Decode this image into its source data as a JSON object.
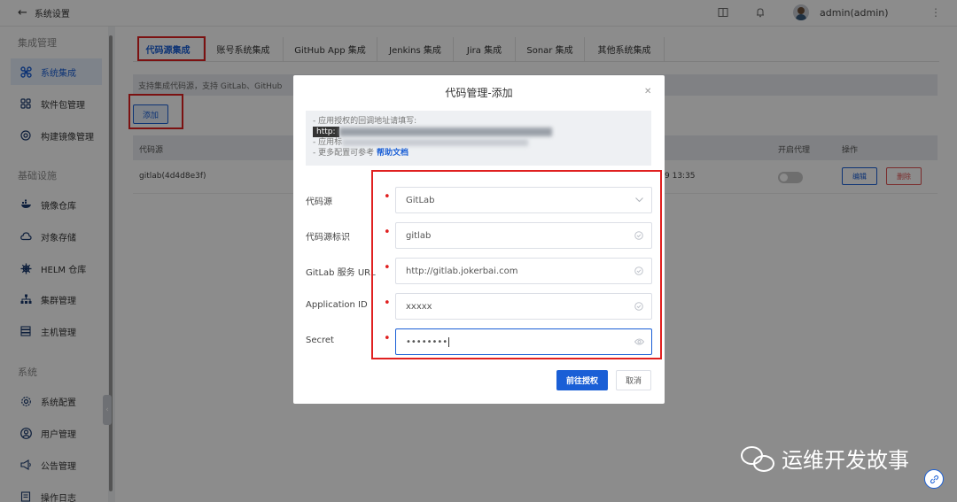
{
  "topbar": {
    "back_label": "系统设置",
    "user_name": "admin(admin)"
  },
  "sidebar": {
    "groups": [
      {
        "title": "集成管理",
        "items": [
          {
            "label": "系统集成",
            "icon": "integration-icon",
            "active": true
          },
          {
            "label": "软件包管理",
            "icon": "grid-icon"
          },
          {
            "label": "构建镜像管理",
            "icon": "disc-icon"
          }
        ]
      },
      {
        "title": "基础设施",
        "items": [
          {
            "label": "镜像仓库",
            "icon": "docker-icon"
          },
          {
            "label": "对象存储",
            "icon": "cloud-icon"
          },
          {
            "label": "HELM 仓库",
            "icon": "helm-icon"
          },
          {
            "label": "集群管理",
            "icon": "cluster-icon"
          },
          {
            "label": "主机管理",
            "icon": "server-icon"
          }
        ]
      },
      {
        "title": "系统",
        "items": [
          {
            "label": "系统配置",
            "icon": "gear-icon"
          },
          {
            "label": "用户管理",
            "icon": "user-icon"
          },
          {
            "label": "公告管理",
            "icon": "megaphone-icon"
          },
          {
            "label": "操作日志",
            "icon": "log-icon"
          }
        ]
      }
    ]
  },
  "tabs": [
    "代码源集成",
    "账号系统集成",
    "GitHub App 集成",
    "Jenkins 集成",
    "Jira 集成",
    "Sonar 集成",
    "其他系统集成"
  ],
  "info_text": "支持集成代码源，支持 GitLab、GitHub",
  "add_button": "添加",
  "table": {
    "headers": {
      "source": "代码源",
      "proxy": "开启代理",
      "actions": "操作"
    },
    "rows": [
      {
        "name": "gitlab(4d4d8e3f)",
        "time": "9 13:35",
        "edit": "编辑",
        "delete": "删除"
      }
    ]
  },
  "modal": {
    "title": "代码管理-添加",
    "tip": {
      "line1": "- 应用授权的回调地址请填写:",
      "url_prefix": "http:",
      "line3": "- 应用标",
      "line4_prefix": "- 更多配置可参考",
      "help_link": "帮助文档"
    },
    "fields": [
      {
        "label": "代码源",
        "value": "GitLab",
        "suffix": "chevron-down-icon"
      },
      {
        "label": "代码源标识",
        "value": "gitlab",
        "suffix": "check-circle-icon"
      },
      {
        "label": "GitLab 服务 URL",
        "value": "http://gitlab.jokerbai.com",
        "suffix": "check-circle-icon"
      },
      {
        "label": "Application ID",
        "value": "xxxxx",
        "suffix": "check-circle-icon"
      },
      {
        "label": "Secret",
        "value": "••••••••",
        "suffix": "eye-icon"
      }
    ],
    "confirm": "前往授权",
    "cancel": "取消"
  },
  "watermark": "运维开发故事",
  "colors": {
    "primary": "#1a5fd6",
    "annotation_red": "#e02020"
  }
}
